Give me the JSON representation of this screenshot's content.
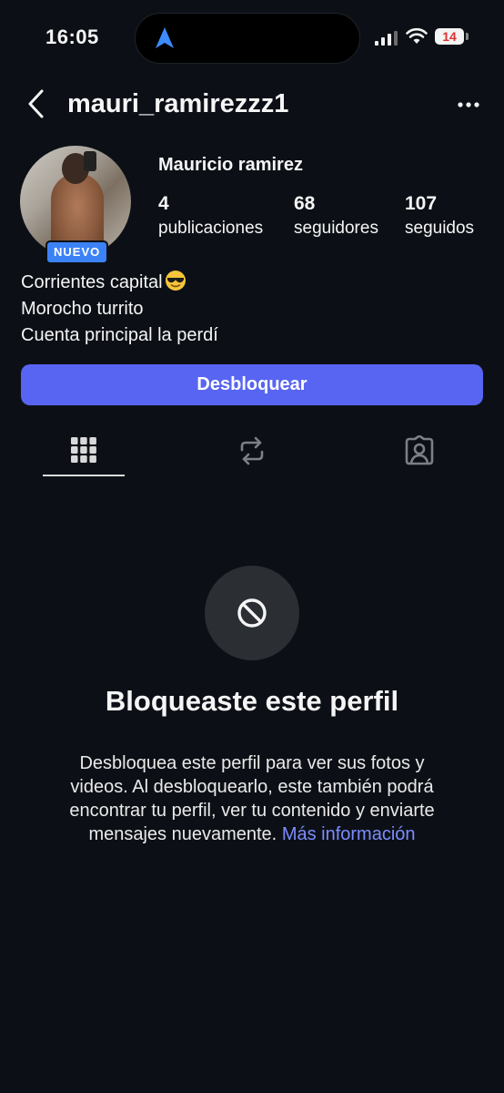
{
  "status_bar": {
    "time": "16:05",
    "battery": "14",
    "icons": [
      "location-arrow-icon",
      "signal-icon",
      "wifi-icon",
      "battery-icon"
    ]
  },
  "header": {
    "username": "mauri_ramirezzz1",
    "back_icon": "chevron-left-icon",
    "more_icon": "more-horizontal-icon"
  },
  "profile": {
    "badge": "NUEVO",
    "full_name": "Mauricio ramirez",
    "stats": [
      {
        "number": "4",
        "label": "publicaciones"
      },
      {
        "number": "68",
        "label": "seguidores"
      },
      {
        "number": "107",
        "label": "seguidos"
      }
    ],
    "bio": [
      "Corrientes capital",
      "Morocho turrito",
      "Cuenta principal la perdí"
    ],
    "bio_emoji": "sunglasses-emoji"
  },
  "actions": {
    "unblock_label": "Desbloquear"
  },
  "tabs": [
    {
      "name": "grid",
      "icon": "grid-icon",
      "active": true
    },
    {
      "name": "reposts",
      "icon": "repost-icon",
      "active": false
    },
    {
      "name": "tagged",
      "icon": "tagged-person-icon",
      "active": false
    }
  ],
  "blocked": {
    "icon": "block-icon",
    "title": "Bloqueaste este perfil",
    "description": "Desbloquea este perfil para ver sus fotos y videos. Al desbloquearlo, este también podrá encontrar tu perfil, ver tu contenido y enviarte mensajes nuevamente.",
    "link": "Más información"
  },
  "colors": {
    "background": "#0c1016",
    "primary_button": "#5865f2",
    "badge": "#3b82f6",
    "link": "#7c8cff",
    "battery_text": "#e03131"
  }
}
